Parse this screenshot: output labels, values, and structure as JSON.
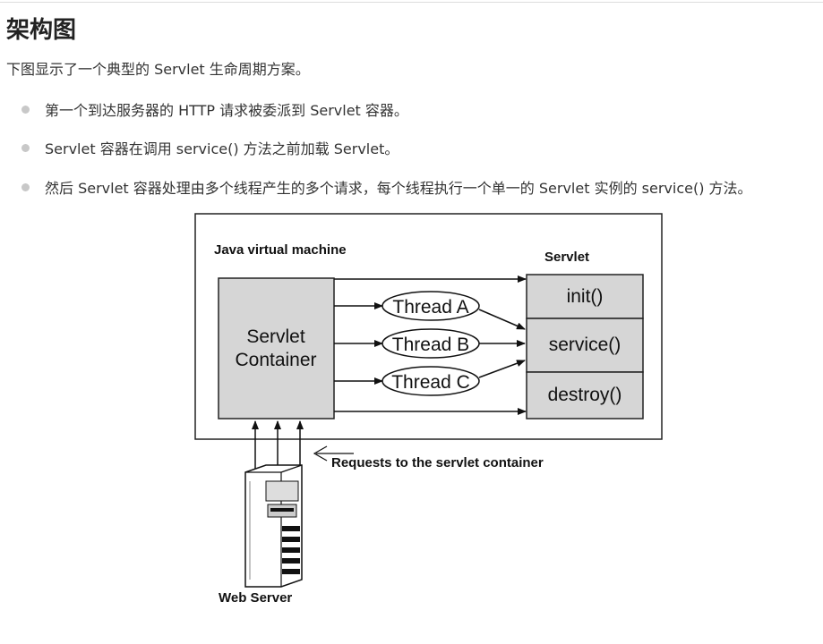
{
  "page": {
    "title": "架构图",
    "intro": "下图显示了一个典型的 Servlet 生命周期方案。",
    "bullets": [
      "第一个到达服务器的 HTTP 请求被委派到 Servlet 容器。",
      "Servlet 容器在调用 service() 方法之前加载 Servlet。",
      "然后 Servlet 容器处理由多个线程产生的多个请求，每个线程执行一个单一的 Servlet 实例的 service() 方法。"
    ]
  },
  "diagram": {
    "jvm_label": "Java virtual machine",
    "servlet_label": "Servlet",
    "container_label_line1": "Servlet",
    "container_label_line2": "Container",
    "threads": [
      "Thread A",
      "Thread B",
      "Thread C"
    ],
    "methods": [
      "init()",
      "service()",
      "destroy()"
    ],
    "requests_label": "Requests to the servlet container",
    "web_server_label": "Web Server"
  }
}
